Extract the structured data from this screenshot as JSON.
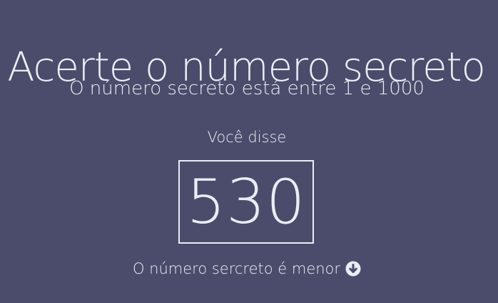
{
  "game": {
    "title": "Acerte o número secreto",
    "range_text": "O número secreto está entre 1 e 1000",
    "you_said_label": "Você disse",
    "guess_value": "530",
    "hint_text": "O número sercreto é menor",
    "hint_icon": "arrow-down-circle-icon"
  },
  "colors": {
    "background": "#4b4c6b",
    "foreground": "#e9eef5"
  }
}
